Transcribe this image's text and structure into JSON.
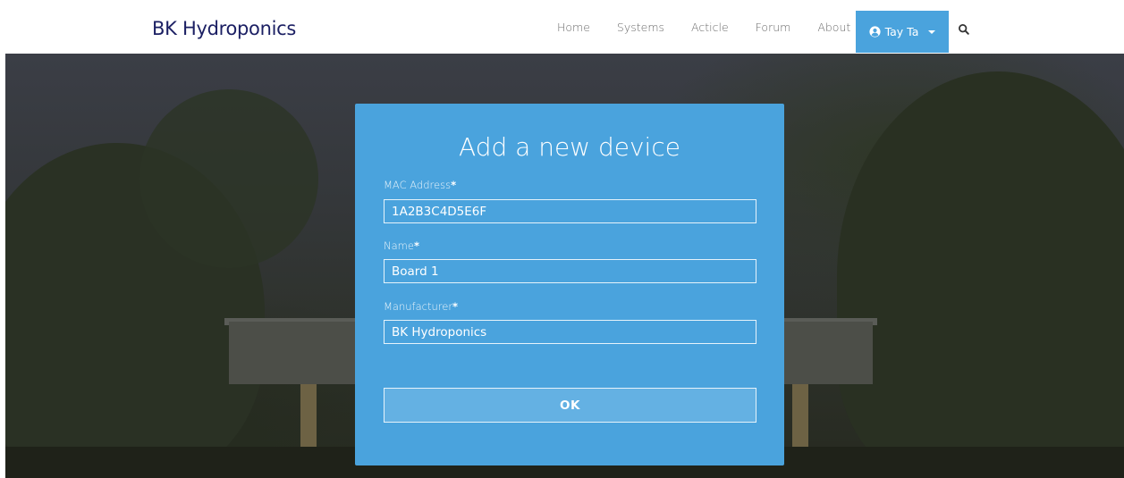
{
  "navbar": {
    "brand": "BK Hydroponics",
    "links": [
      {
        "label": "Home"
      },
      {
        "label": "Systems"
      },
      {
        "label": "Acticle"
      },
      {
        "label": "Forum"
      },
      {
        "label": "About"
      }
    ],
    "user": {
      "label": "Tay Ta",
      "icon": "user-circle-icon"
    },
    "search_icon": "search-icon",
    "accent_color": "#4aa3dd",
    "brand_color": "#1b1f63"
  },
  "modal": {
    "title": "Add a new device",
    "fields": [
      {
        "label": "MAC Address",
        "required_mark": "*",
        "value": "1A2B3C4D5E6F"
      },
      {
        "label": "Name",
        "required_mark": "*",
        "value": "Board 1"
      },
      {
        "label": "Manufacturer",
        "required_mark": "*",
        "value": "BK Hydroponics"
      }
    ],
    "ok_label": "OK",
    "background_color": "#4aa3dd"
  }
}
